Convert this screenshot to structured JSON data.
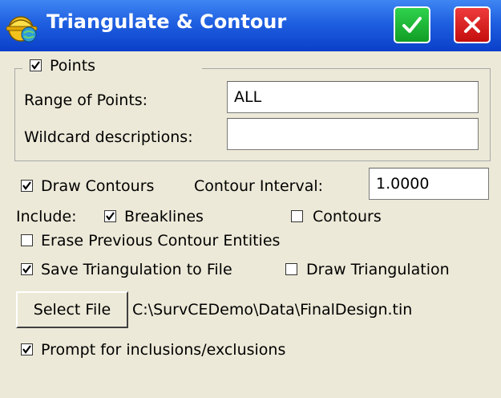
{
  "window": {
    "title": "Triangulate & Contour",
    "ok_icon": "checkmark-icon",
    "close_icon": "close-icon",
    "app_icon": "surveyor-hardhat-icon",
    "colors": {
      "titlebar": "#1f5fe0",
      "ok": "#1fb83a",
      "close": "#d81c1c",
      "background": "#ece9d8"
    }
  },
  "points_group": {
    "points_label": "Points",
    "points_checked": true,
    "range_label": "Range of Points:",
    "range_value": "ALL",
    "wildcard_label": "Wildcard descriptions:",
    "wildcard_value": ""
  },
  "contours": {
    "draw_contours_label": "Draw Contours",
    "draw_contours_checked": true,
    "interval_label": "Contour Interval:",
    "interval_value": "1.0000"
  },
  "include": {
    "label": "Include:",
    "breaklines_label": "Breaklines",
    "breaklines_checked": true,
    "contours_label": "Contours",
    "contours_checked": false
  },
  "options": {
    "erase_label": "Erase Previous Contour Entities",
    "erase_checked": false,
    "save_label": "Save Triangulation to File",
    "save_checked": true,
    "draw_tri_label": "Draw Triangulation",
    "draw_tri_checked": false
  },
  "file": {
    "button_label": "Select File",
    "path": "C:\\SurvCEDemo\\Data\\FinalDesign.tin"
  },
  "prompt": {
    "label": "Prompt for inclusions/exclusions",
    "checked": true
  }
}
